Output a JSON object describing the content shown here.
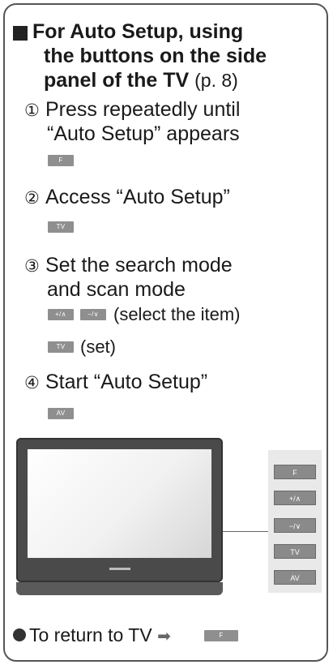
{
  "heading": {
    "line1": "For Auto Setup, using",
    "line2": "the buttons on the side",
    "line3": "panel of the TV",
    "page_ref": "(p. 8)"
  },
  "steps": [
    {
      "num": "①",
      "line1": "Press repeatedly until",
      "line2": "“Auto Setup” appears",
      "buttons": [
        "F"
      ]
    },
    {
      "num": "②",
      "line1": "Access “Auto Setup”",
      "buttons": [
        "TV"
      ]
    },
    {
      "num": "③",
      "line1": "Set the search mode",
      "line2": "and scan mode",
      "buttons_a": [
        "+/∧",
        "−/∨"
      ],
      "note_a": "(select the item)",
      "buttons_b": [
        "TV"
      ],
      "note_b": "(set)"
    },
    {
      "num": "④",
      "line1": "Start “Auto Setup”",
      "buttons": [
        "AV"
      ]
    }
  ],
  "side_panel_buttons": [
    "F",
    "+/∧",
    "−/∨",
    "TV",
    "AV"
  ],
  "footer": {
    "text": "To return to TV",
    "button": "F"
  },
  "colors": {
    "button_bg": "#8f8f8f",
    "text": "#1a1a1a",
    "frame": "#555555"
  }
}
